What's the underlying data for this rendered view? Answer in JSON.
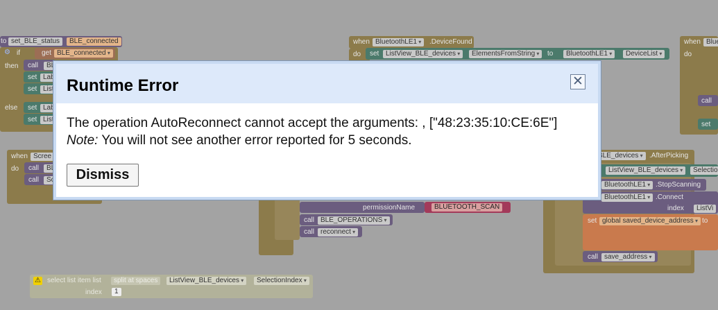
{
  "workspace": {
    "b1": {
      "to": "to",
      "name": "set_BLE_status",
      "param": "BLE_connected",
      "if": "if",
      "get": "get",
      "get_var": "BLE_connected",
      "then": "then",
      "call": "call",
      "call_target": "BL",
      "set": "set",
      "set_a": "Lab",
      "set_b": "List",
      "else": "else",
      "else_a": "Lab",
      "else_b": "List"
    },
    "b2": {
      "when": "when",
      "component": "BluetoothLE1",
      "event": ".DeviceFound",
      "do": "do",
      "set": "set",
      "target": "ListView_BLE_devices",
      "prop": "ElementsFromString",
      "to": "to",
      "source": "BluetoothLE1",
      "source_prop": "DeviceList"
    },
    "b3": {
      "when": "when",
      "comp": "Blue",
      "do": "do",
      "call": "call",
      "set": "set"
    },
    "b4": {
      "when": "when",
      "comp": "Scree",
      "do": "do",
      "call": "call",
      "a": "BL",
      "b": "Sc"
    },
    "b5": {
      "perm_label": "permissionName",
      "perm_value": "BLUETOOTH_SCAN",
      "call": "call",
      "ops": "BLE_OPERATIONS",
      "reconnect": "reconnect"
    },
    "b6": {
      "event_comp": "BLE_devices",
      "event": ".AfterPicking",
      "set_target": "ListView_BLE_devices",
      "set_prop": "Selectio",
      "stop_comp": "BluetoothLE1",
      "stop": ".StopScanning",
      "conn_comp": "BluetoothLE1",
      "conn": ".Connect",
      "index": "index",
      "index_val": "ListVi",
      "set": "set",
      "global": "global saved_device_address",
      "to": "to",
      "call": "call",
      "save": "save_address"
    },
    "b7": {
      "warn": "select list item  list",
      "split": "split at spaces",
      "list": "ListView_BLE_devices",
      "sel": "SelectionIndex",
      "index": "index",
      "num": "1"
    }
  },
  "dialog": {
    "title": "Runtime Error",
    "line1": "The operation AutoReconnect cannot accept the arguments: , [\"48:23:35:10:CE:6E\"]",
    "note_label": "Note:",
    "note_text": " You will not see another error reported for 5 seconds.",
    "dismiss_label": "Dismiss",
    "close_glyph": "✕"
  }
}
